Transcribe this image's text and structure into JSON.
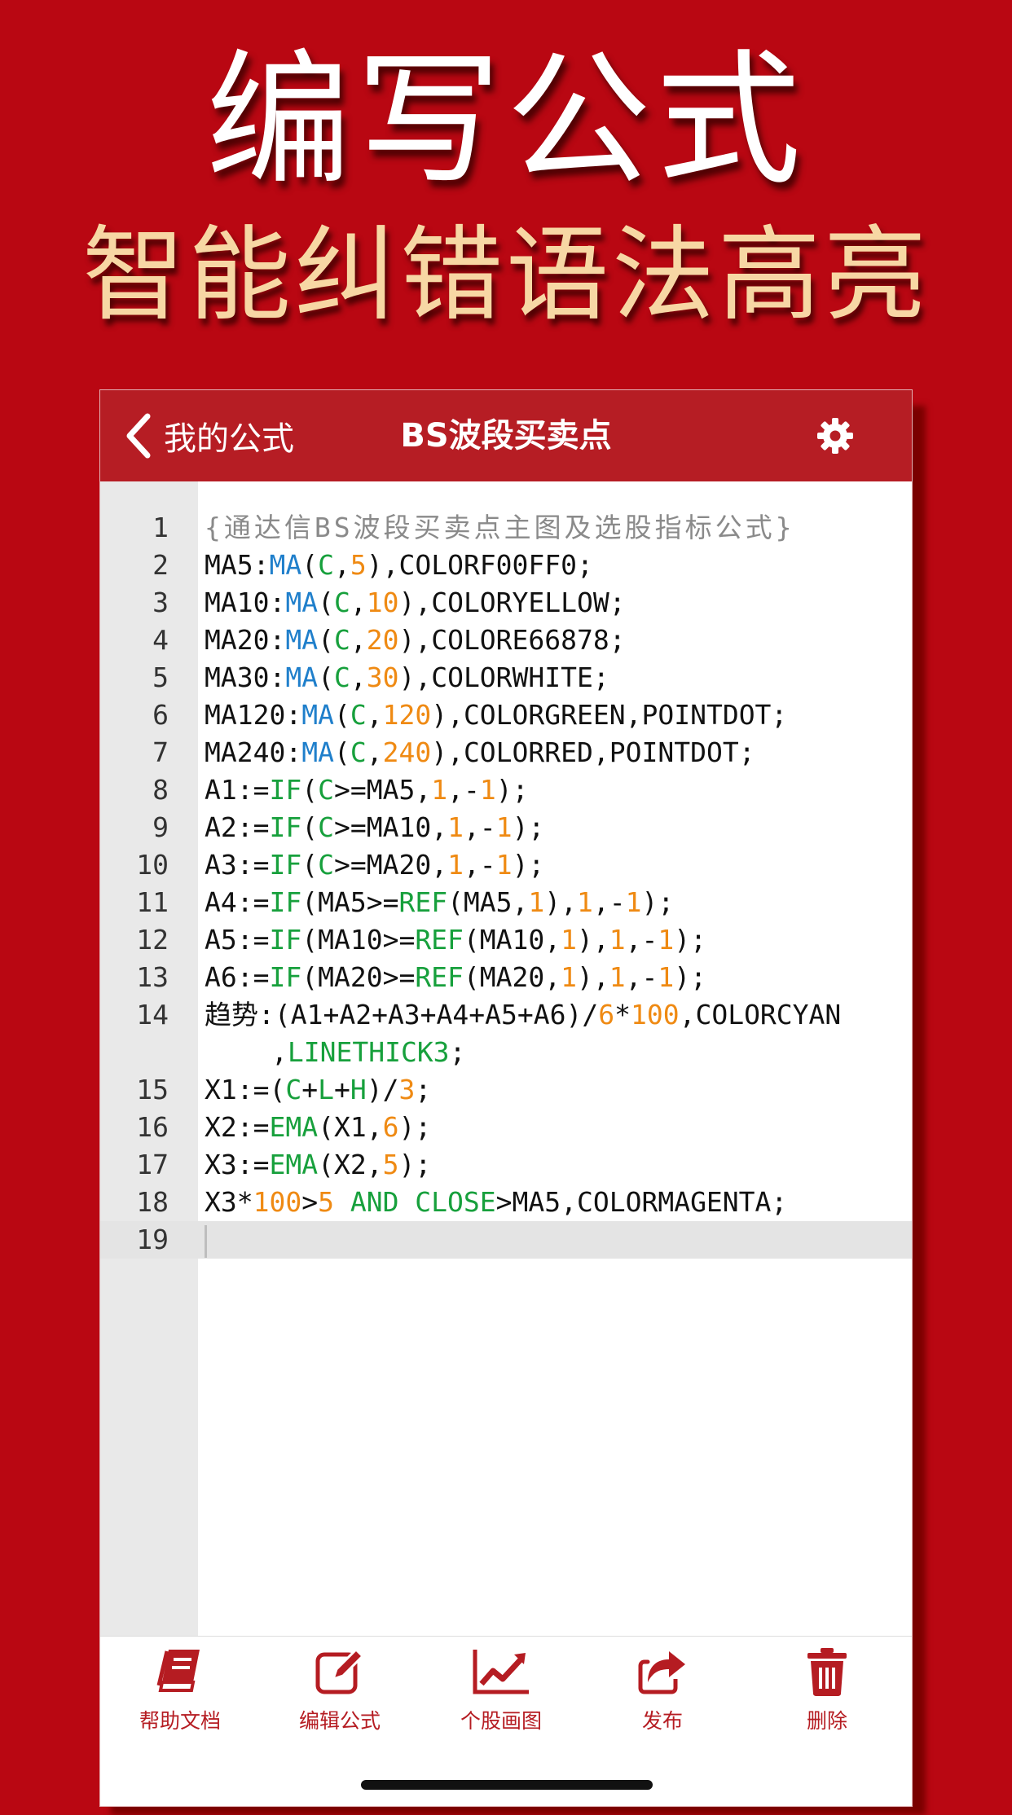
{
  "promo": {
    "title": "编写公式",
    "subtitle": "智能纠错语法高亮"
  },
  "navbar": {
    "back_label": "我的公式",
    "title": "BS波段买卖点"
  },
  "editor": {
    "active_line": 19,
    "lines": [
      {
        "no": "1",
        "tokens": [
          {
            "t": "{通达信BS波段买卖点主图及选股指标公式}",
            "c": "cm"
          }
        ]
      },
      {
        "no": "2",
        "tokens": [
          {
            "t": "MA5:",
            "c": "pl"
          },
          {
            "t": "MA",
            "c": "fn"
          },
          {
            "t": "(",
            "c": "pl"
          },
          {
            "t": "C",
            "c": "kw"
          },
          {
            "t": ",",
            "c": "pl"
          },
          {
            "t": "5",
            "c": "num"
          },
          {
            "t": "),COLORF00FF0;",
            "c": "pl"
          }
        ]
      },
      {
        "no": "3",
        "tokens": [
          {
            "t": "MA10:",
            "c": "pl"
          },
          {
            "t": "MA",
            "c": "fn"
          },
          {
            "t": "(",
            "c": "pl"
          },
          {
            "t": "C",
            "c": "kw"
          },
          {
            "t": ",",
            "c": "pl"
          },
          {
            "t": "10",
            "c": "num"
          },
          {
            "t": "),COLORYELLOW;",
            "c": "pl"
          }
        ]
      },
      {
        "no": "4",
        "tokens": [
          {
            "t": "MA20:",
            "c": "pl"
          },
          {
            "t": "MA",
            "c": "fn"
          },
          {
            "t": "(",
            "c": "pl"
          },
          {
            "t": "C",
            "c": "kw"
          },
          {
            "t": ",",
            "c": "pl"
          },
          {
            "t": "20",
            "c": "num"
          },
          {
            "t": "),COLORE66878;",
            "c": "pl"
          }
        ]
      },
      {
        "no": "5",
        "tokens": [
          {
            "t": "MA30:",
            "c": "pl"
          },
          {
            "t": "MA",
            "c": "fn"
          },
          {
            "t": "(",
            "c": "pl"
          },
          {
            "t": "C",
            "c": "kw"
          },
          {
            "t": ",",
            "c": "pl"
          },
          {
            "t": "30",
            "c": "num"
          },
          {
            "t": "),COLORWHITE;",
            "c": "pl"
          }
        ]
      },
      {
        "no": "6",
        "tokens": [
          {
            "t": "MA120:",
            "c": "pl"
          },
          {
            "t": "MA",
            "c": "fn"
          },
          {
            "t": "(",
            "c": "pl"
          },
          {
            "t": "C",
            "c": "kw"
          },
          {
            "t": ",",
            "c": "pl"
          },
          {
            "t": "120",
            "c": "num"
          },
          {
            "t": "),COLORGREEN,POINTDOT;",
            "c": "pl"
          }
        ]
      },
      {
        "no": "7",
        "tokens": [
          {
            "t": "MA240:",
            "c": "pl"
          },
          {
            "t": "MA",
            "c": "fn"
          },
          {
            "t": "(",
            "c": "pl"
          },
          {
            "t": "C",
            "c": "kw"
          },
          {
            "t": ",",
            "c": "pl"
          },
          {
            "t": "240",
            "c": "num"
          },
          {
            "t": "),COLORRED,POINTDOT;",
            "c": "pl"
          }
        ]
      },
      {
        "no": "8",
        "tokens": [
          {
            "t": "A1:=",
            "c": "pl"
          },
          {
            "t": "IF",
            "c": "kw"
          },
          {
            "t": "(",
            "c": "pl"
          },
          {
            "t": "C",
            "c": "kw"
          },
          {
            "t": ">=MA5,",
            "c": "pl"
          },
          {
            "t": "1",
            "c": "num"
          },
          {
            "t": ",-",
            "c": "pl"
          },
          {
            "t": "1",
            "c": "num"
          },
          {
            "t": ");",
            "c": "pl"
          }
        ]
      },
      {
        "no": "9",
        "tokens": [
          {
            "t": "A2:=",
            "c": "pl"
          },
          {
            "t": "IF",
            "c": "kw"
          },
          {
            "t": "(",
            "c": "pl"
          },
          {
            "t": "C",
            "c": "kw"
          },
          {
            "t": ">=MA10,",
            "c": "pl"
          },
          {
            "t": "1",
            "c": "num"
          },
          {
            "t": ",-",
            "c": "pl"
          },
          {
            "t": "1",
            "c": "num"
          },
          {
            "t": ");",
            "c": "pl"
          }
        ]
      },
      {
        "no": "10",
        "tokens": [
          {
            "t": "A3:=",
            "c": "pl"
          },
          {
            "t": "IF",
            "c": "kw"
          },
          {
            "t": "(",
            "c": "pl"
          },
          {
            "t": "C",
            "c": "kw"
          },
          {
            "t": ">=MA20,",
            "c": "pl"
          },
          {
            "t": "1",
            "c": "num"
          },
          {
            "t": ",-",
            "c": "pl"
          },
          {
            "t": "1",
            "c": "num"
          },
          {
            "t": ");",
            "c": "pl"
          }
        ]
      },
      {
        "no": "11",
        "tokens": [
          {
            "t": "A4:=",
            "c": "pl"
          },
          {
            "t": "IF",
            "c": "kw"
          },
          {
            "t": "(MA5>=",
            "c": "pl"
          },
          {
            "t": "REF",
            "c": "kw"
          },
          {
            "t": "(MA5,",
            "c": "pl"
          },
          {
            "t": "1",
            "c": "num"
          },
          {
            "t": "),",
            "c": "pl"
          },
          {
            "t": "1",
            "c": "num"
          },
          {
            "t": ",-",
            "c": "pl"
          },
          {
            "t": "1",
            "c": "num"
          },
          {
            "t": ");",
            "c": "pl"
          }
        ]
      },
      {
        "no": "12",
        "tokens": [
          {
            "t": "A5:=",
            "c": "pl"
          },
          {
            "t": "IF",
            "c": "kw"
          },
          {
            "t": "(MA10>=",
            "c": "pl"
          },
          {
            "t": "REF",
            "c": "kw"
          },
          {
            "t": "(MA10,",
            "c": "pl"
          },
          {
            "t": "1",
            "c": "num"
          },
          {
            "t": "),",
            "c": "pl"
          },
          {
            "t": "1",
            "c": "num"
          },
          {
            "t": ",-",
            "c": "pl"
          },
          {
            "t": "1",
            "c": "num"
          },
          {
            "t": ");",
            "c": "pl"
          }
        ]
      },
      {
        "no": "13",
        "tokens": [
          {
            "t": "A6:=",
            "c": "pl"
          },
          {
            "t": "IF",
            "c": "kw"
          },
          {
            "t": "(MA20>=",
            "c": "pl"
          },
          {
            "t": "REF",
            "c": "kw"
          },
          {
            "t": "(MA20,",
            "c": "pl"
          },
          {
            "t": "1",
            "c": "num"
          },
          {
            "t": "),",
            "c": "pl"
          },
          {
            "t": "1",
            "c": "num"
          },
          {
            "t": ",-",
            "c": "pl"
          },
          {
            "t": "1",
            "c": "num"
          },
          {
            "t": ");",
            "c": "pl"
          }
        ]
      },
      {
        "no": "14",
        "tokens": [
          {
            "t": "趋势:(A1+A2+A3+A4+A5+A6)/",
            "c": "pl"
          },
          {
            "t": "6",
            "c": "num"
          },
          {
            "t": "*",
            "c": "pl"
          },
          {
            "t": "100",
            "c": "num"
          },
          {
            "t": ",COLORCYAN",
            "c": "pl"
          }
        ],
        "cont": [
          {
            "t": ",",
            "c": "pl"
          },
          {
            "t": "LINETHICK3",
            "c": "kw"
          },
          {
            "t": ";",
            "c": "pl"
          }
        ]
      },
      {
        "no": "15",
        "tokens": [
          {
            "t": "X1:=(",
            "c": "pl"
          },
          {
            "t": "C",
            "c": "kw"
          },
          {
            "t": "+",
            "c": "pl"
          },
          {
            "t": "L",
            "c": "kw"
          },
          {
            "t": "+",
            "c": "pl"
          },
          {
            "t": "H",
            "c": "kw"
          },
          {
            "t": ")/",
            "c": "pl"
          },
          {
            "t": "3",
            "c": "num"
          },
          {
            "t": ";",
            "c": "pl"
          }
        ]
      },
      {
        "no": "16",
        "tokens": [
          {
            "t": "X2:=",
            "c": "pl"
          },
          {
            "t": "EMA",
            "c": "kw"
          },
          {
            "t": "(X1,",
            "c": "pl"
          },
          {
            "t": "6",
            "c": "num"
          },
          {
            "t": ");",
            "c": "pl"
          }
        ]
      },
      {
        "no": "17",
        "tokens": [
          {
            "t": "X3:=",
            "c": "pl"
          },
          {
            "t": "EMA",
            "c": "kw"
          },
          {
            "t": "(X2,",
            "c": "pl"
          },
          {
            "t": "5",
            "c": "num"
          },
          {
            "t": ");",
            "c": "pl"
          }
        ]
      },
      {
        "no": "18",
        "tokens": [
          {
            "t": "X3*",
            "c": "pl"
          },
          {
            "t": "100",
            "c": "num"
          },
          {
            "t": ">",
            "c": "pl"
          },
          {
            "t": "5",
            "c": "num"
          },
          {
            "t": " AND CLOSE",
            "c": "kw"
          },
          {
            "t": ">MA5,COLORMAGENTA;",
            "c": "pl"
          }
        ]
      },
      {
        "no": "19",
        "tokens": []
      }
    ]
  },
  "toolbar": {
    "help_label": "帮助文档",
    "edit_label": "编辑公式",
    "chart_label": "个股画图",
    "publish_label": "发布",
    "delete_label": "删除"
  },
  "icons": {
    "back": "chevron-left-icon",
    "settings": "gear-icon",
    "help": "book-icon",
    "edit": "edit-icon",
    "chart": "line-chart-icon",
    "publish": "share-icon",
    "delete": "trash-icon"
  },
  "colors": {
    "background": "#b90712",
    "navbar": "#b61d24",
    "subtitle": "#f7d7a4",
    "function": "#1f7fcb",
    "keyword": "#17a03c",
    "number": "#ef8a13",
    "comment": "#8a8a8a",
    "toolbar_accent": "#b51c22"
  }
}
